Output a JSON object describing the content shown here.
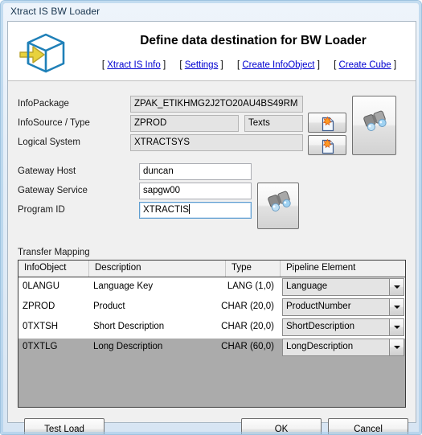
{
  "window": {
    "title": "Xtract IS BW Loader"
  },
  "header": {
    "icon": "cube-import-icon",
    "title": "Define data destination for BW Loader",
    "links": [
      {
        "label": "Xtract IS Info",
        "name": "xtract-is-info"
      },
      {
        "label": "Settings",
        "name": "settings"
      },
      {
        "label": "Create InfoObject",
        "name": "create-infoobject"
      },
      {
        "label": "Create Cube",
        "name": "create-cube"
      }
    ],
    "bracket_open": "[",
    "bracket_close": "]"
  },
  "destination": {
    "fields": [
      {
        "label": "InfoPackage",
        "value": "ZPAK_ETIKHMG2J2TO20AU4BS49RM",
        "readonly": true
      },
      {
        "label": "InfoSource / Type",
        "value": "ZPROD",
        "readonly": true
      },
      {
        "label": "Logical System",
        "value": "XTRACTSYS",
        "readonly": true
      }
    ],
    "type_value": "Texts",
    "new_infopackage_button": {
      "icon": "new-document-icon"
    },
    "new_infosource_button": {
      "icon": "new-document-icon"
    },
    "browse_button": {
      "icon": "binoculars-icon"
    }
  },
  "gateway": {
    "fields": [
      {
        "label": "Gateway Host",
        "value": "duncan",
        "focused": false
      },
      {
        "label": "Gateway Service",
        "value": "sapgw00",
        "focused": false
      },
      {
        "label": "Program ID",
        "value": "XTRACTIS",
        "focused": true
      }
    ],
    "browse_button": {
      "icon": "binoculars-icon"
    }
  },
  "transfer_mapping": {
    "group_label": "Transfer Mapping",
    "columns": [
      "InfoObject",
      "Description",
      "Type",
      "Pipeline Element"
    ],
    "rows": [
      {
        "infoobject": "0LANGU",
        "description": "Language Key",
        "type": "LANG (1,0)",
        "pipeline_element": "Language"
      },
      {
        "infoobject": "ZPROD",
        "description": "Product",
        "type": "CHAR (20,0)",
        "pipeline_element": "ProductNumber"
      },
      {
        "infoobject": "0TXTSH",
        "description": "Short Description",
        "type": "CHAR (20,0)",
        "pipeline_element": "ShortDescription"
      },
      {
        "infoobject": "0TXTLG",
        "description": "Long Description",
        "type": "CHAR (60,0)",
        "pipeline_element": "LongDescription"
      }
    ]
  },
  "footer": {
    "test_load_label": "Test Load",
    "ok_label": "OK",
    "cancel_label": "Cancel"
  },
  "colors": {
    "link": "#0000d0",
    "title_text": "#16334d",
    "dialog_face": "#f0f0f0",
    "grid_empty": "#ababab",
    "cube_blue": "#1f80b8",
    "cube_arrow_yellow": "#e8d23c"
  }
}
